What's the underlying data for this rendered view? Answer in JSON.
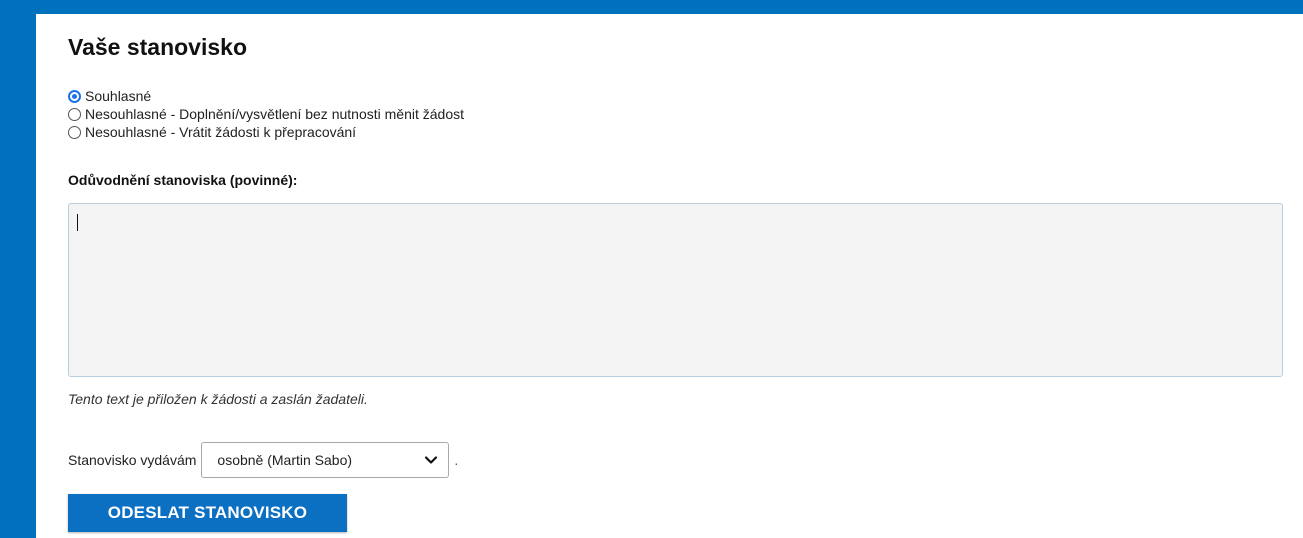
{
  "form": {
    "title": "Vaše stanovisko",
    "options": [
      {
        "label": "Souhlasné",
        "checked": true
      },
      {
        "label": "Nesouhlasné - Doplnění/vysvětlení bez nutnosti měnit žádost",
        "checked": false
      },
      {
        "label": "Nesouhlasné - Vrátit žádosti k přepracování",
        "checked": false
      }
    ],
    "justification_label": "Odůvodnění stanoviska (povinné):",
    "justification_value": "",
    "hint": "Tento text je přiložen k žádosti a zaslán žadateli.",
    "issuer_label": "Stanovisko vydávám",
    "issuer_selected": "osobně (Martin Sabo)",
    "issuer_suffix": ".",
    "submit_label": "ODESLAT STANOVISKO"
  },
  "colors": {
    "frame": "#0071bc",
    "button": "#0b6fc2",
    "radio_checked": "#1a73e8"
  }
}
